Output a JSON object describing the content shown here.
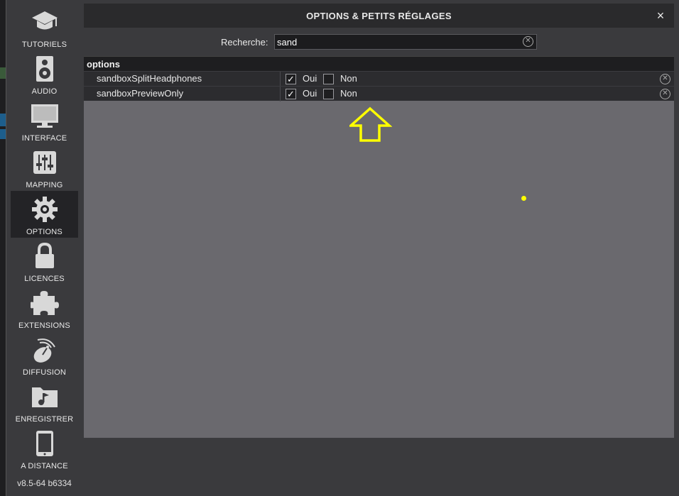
{
  "window": {
    "title": "OPTIONS & PETITS RÉGLAGES",
    "close_glyph": "×"
  },
  "sidebar": {
    "items": [
      {
        "label": "TUTORIELS",
        "icon": "graduation-cap-icon"
      },
      {
        "label": "AUDIO",
        "icon": "speaker-icon"
      },
      {
        "label": "INTERFACE",
        "icon": "monitor-icon"
      },
      {
        "label": "MAPPING",
        "icon": "sliders-icon"
      },
      {
        "label": "OPTIONS",
        "icon": "gear-icon",
        "active": true
      },
      {
        "label": "LICENCES",
        "icon": "lock-icon"
      },
      {
        "label": "EXTENSIONS",
        "icon": "puzzle-icon"
      },
      {
        "label": "DIFFUSION",
        "icon": "satellite-dish-icon"
      },
      {
        "label": "ENREGISTRER",
        "icon": "music-folder-icon"
      },
      {
        "label": "A DISTANCE",
        "icon": "tablet-icon"
      }
    ],
    "version": "v8.5-64 b6334"
  },
  "search": {
    "label": "Recherche:",
    "value": "sand",
    "clear_glyph": "⊗"
  },
  "table": {
    "section": "options",
    "rows": [
      {
        "name": "sandboxSplitHeadphones",
        "yes_label": "Oui",
        "no_label": "Non",
        "yes_checked": true,
        "no_checked": false,
        "check_glyph": "✓",
        "reset_glyph": "✕"
      },
      {
        "name": "sandboxPreviewOnly",
        "yes_label": "Oui",
        "no_label": "Non",
        "yes_checked": true,
        "no_checked": false,
        "check_glyph": "✓",
        "reset_glyph": "✕"
      }
    ]
  },
  "colors": {
    "annotation": "#ffff00",
    "panel_bg": "#6a696e",
    "sidebar_bg": "#3a3a3d"
  }
}
